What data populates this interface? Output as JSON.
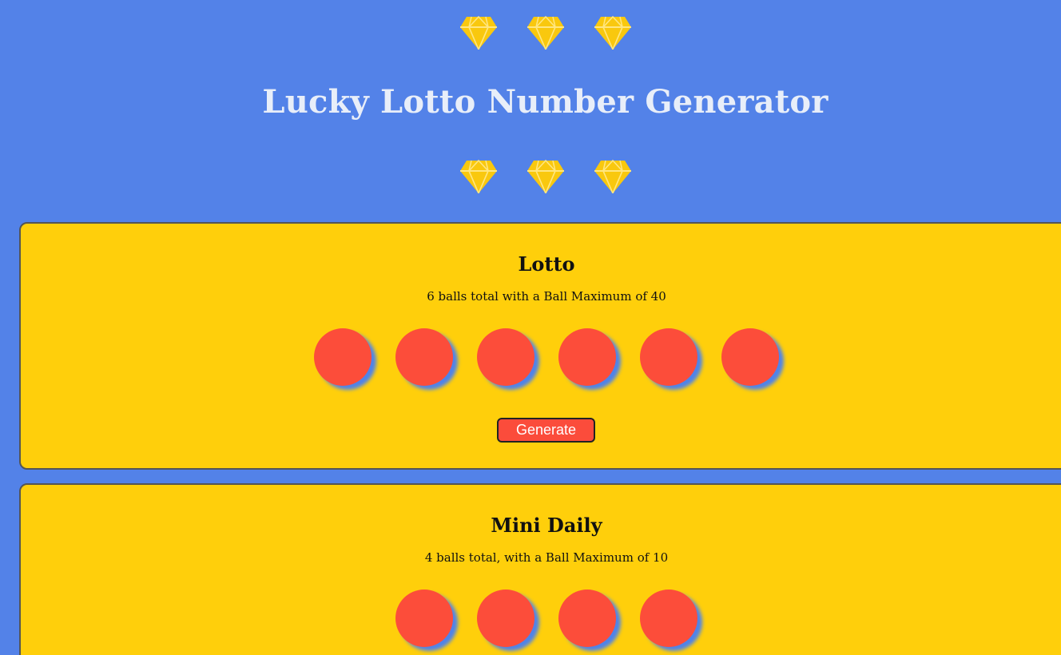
{
  "header": {
    "title": "Lucky Lotto Number Generator",
    "decoration_icon": "diamond-icon",
    "decoration_color": "#f9c80e"
  },
  "colors": {
    "background": "#5382e8",
    "card": "#ffcf0b",
    "ball": "#fc4d3a",
    "title_text": "#e8eef9"
  },
  "games": [
    {
      "title": "Lotto",
      "description": "6 balls total with a Ball Maximum of 40",
      "ball_count": 6,
      "button_label": "Generate"
    },
    {
      "title": "Mini Daily",
      "description": "4 balls total, with a Ball Maximum of 10",
      "ball_count": 4
    }
  ]
}
